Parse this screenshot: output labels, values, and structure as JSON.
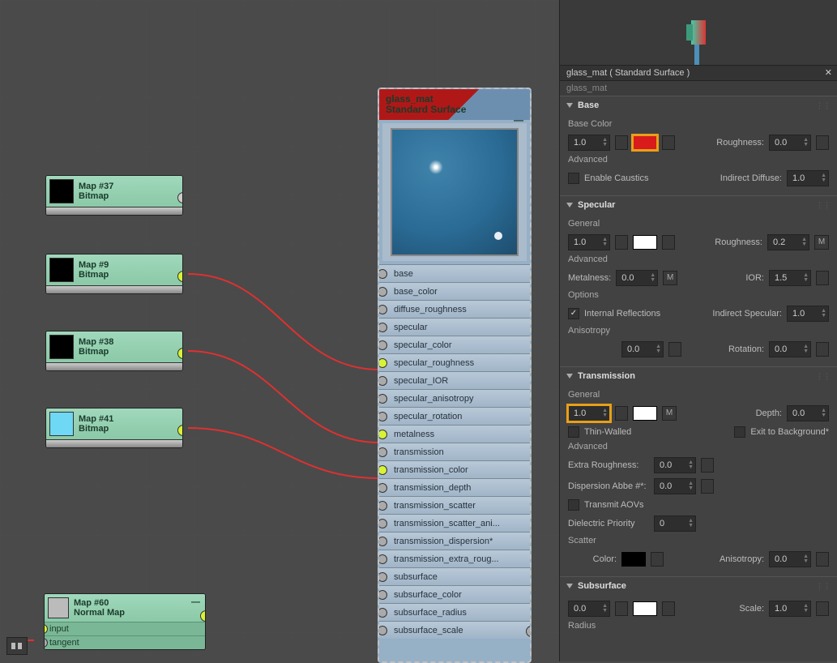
{
  "graph": {
    "node37": {
      "title": "Map #37",
      "type": "Bitmap"
    },
    "node9": {
      "title": "Map #9",
      "type": "Bitmap"
    },
    "node38": {
      "title": "Map #38",
      "type": "Bitmap"
    },
    "node41": {
      "title": "Map #41",
      "type": "Bitmap"
    },
    "node60": {
      "title": "Map #60",
      "type": "Normal Map",
      "row1": "input",
      "row2": "tangent"
    },
    "surface": {
      "title": "glass_mat",
      "subtitle": "Standard Surface",
      "slots": [
        "base",
        "base_color",
        "diffuse_roughness",
        "specular",
        "specular_color",
        "specular_roughness",
        "specular_IOR",
        "specular_anisotropy",
        "specular_rotation",
        "metalness",
        "transmission",
        "transmission_color",
        "transmission_depth",
        "transmission_scatter",
        "transmission_scatter_ani...",
        "transmission_dispersion*",
        "transmission_extra_roug...",
        "subsurface",
        "subsurface_color",
        "subsurface_radius",
        "subsurface_scale"
      ]
    }
  },
  "panel": {
    "titlebar": "glass_mat ( Standard Surface )",
    "breadcrumb": "glass_mat",
    "base": {
      "header": "Base",
      "baseColorLbl": "Base Color",
      "weight": "1.0",
      "roughnessLbl": "Roughness:",
      "roughness": "0.0",
      "advanced": "Advanced",
      "causticsLbl": "Enable Caustics",
      "indirectDiffuseLbl": "Indirect Diffuse:",
      "indirectDiffuse": "1.0"
    },
    "specular": {
      "header": "Specular",
      "general": "General",
      "weight": "1.0",
      "roughnessLbl": "Roughness:",
      "roughness": "0.2",
      "advanced": "Advanced",
      "metalnessLbl": "Metalness:",
      "metalness": "0.0",
      "iorLbl": "IOR:",
      "ior": "1.5",
      "options": "Options",
      "intReflLbl": "Internal Reflections",
      "indirectSpecLbl": "Indirect Specular:",
      "indirectSpec": "1.0",
      "anisotropy": "Anisotropy",
      "anisoVal": "0.0",
      "rotationLbl": "Rotation:",
      "rotation": "0.0"
    },
    "transmission": {
      "header": "Transmission",
      "general": "General",
      "weight": "1.0",
      "depthLbl": "Depth:",
      "depth": "0.0",
      "thinLbl": "Thin-Walled",
      "exitLbl": "Exit to Background*",
      "advanced": "Advanced",
      "extraRoughLbl": "Extra Roughness:",
      "extraRough": "0.0",
      "abbeLbl": "Dispersion Abbe #*:",
      "abbe": "0.0",
      "transmitAOVLbl": "Transmit AOVs",
      "dielectricLbl": "Dielectric Priority",
      "dielectric": "0",
      "scatter": "Scatter",
      "colorLbl": "Color:",
      "anisoLbl": "Anisotropy:",
      "aniso": "0.0"
    },
    "subsurface": {
      "header": "Subsurface",
      "weight": "0.0",
      "scaleLbl": "Scale:",
      "scale": "1.0",
      "radius": "Radius"
    },
    "m": "M"
  }
}
